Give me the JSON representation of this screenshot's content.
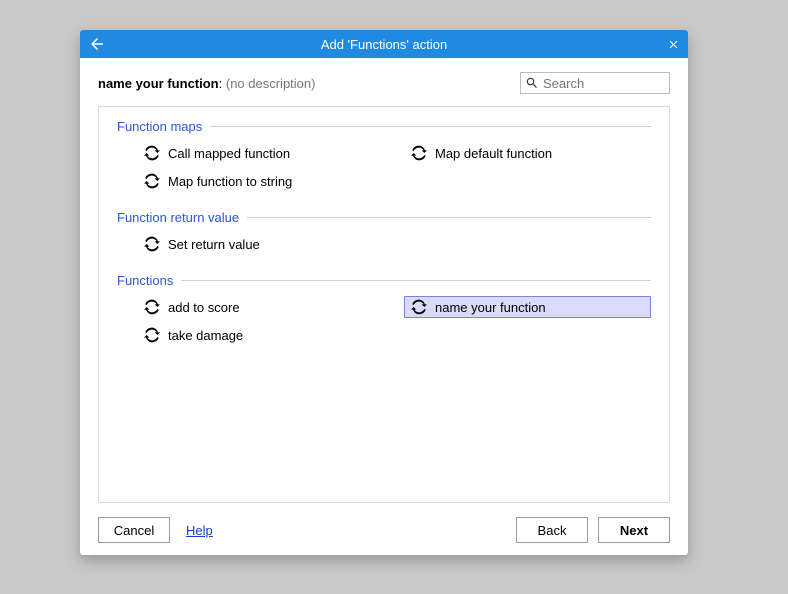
{
  "titlebar": {
    "title": "Add 'Functions' action"
  },
  "header": {
    "function_name": "name your function",
    "description_label": "(no description)"
  },
  "search": {
    "placeholder": "Search",
    "value": ""
  },
  "groups": [
    {
      "title": "Function maps",
      "items": [
        {
          "label": "Call mapped function",
          "selected": false
        },
        {
          "label": "Map default function",
          "selected": false
        },
        {
          "label": "Map function to string",
          "selected": false
        }
      ]
    },
    {
      "title": "Function return value",
      "items": [
        {
          "label": "Set return value",
          "selected": false
        }
      ]
    },
    {
      "title": "Functions",
      "items": [
        {
          "label": "add to score",
          "selected": false
        },
        {
          "label": "name your function",
          "selected": true
        },
        {
          "label": "take damage",
          "selected": false
        }
      ]
    }
  ],
  "footer": {
    "cancel": "Cancel",
    "help": "Help",
    "back": "Back",
    "next": "Next"
  }
}
